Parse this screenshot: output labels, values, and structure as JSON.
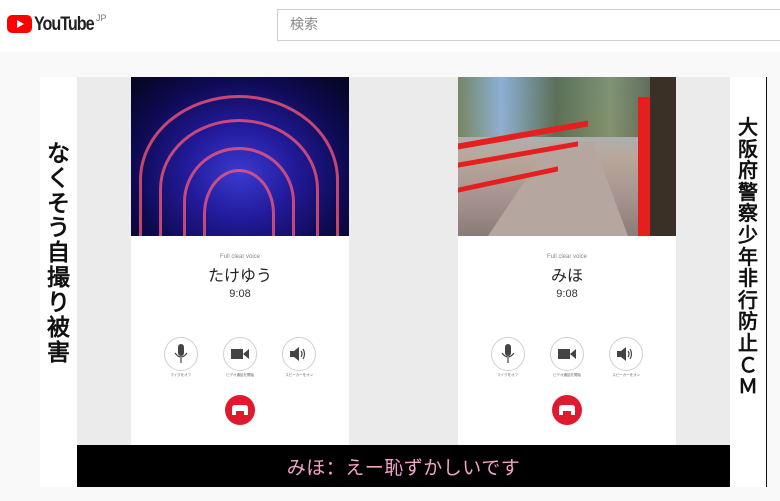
{
  "header": {
    "logo_text": "YouTube",
    "logo_region": "JP",
    "search_placeholder": "検索"
  },
  "video": {
    "side_left_text": [
      "な",
      "く",
      "そ",
      "う",
      "自",
      "撮",
      "り",
      "被",
      "害"
    ],
    "side_right_text": [
      "大",
      "阪",
      "府",
      "警",
      "察",
      "少",
      "年",
      "非",
      "行",
      "防",
      "止",
      "Ｃ",
      "Ｍ"
    ],
    "phones": [
      {
        "photo": "illumination-tunnel",
        "subtitle": "Full clear voice",
        "caller_name": "たけゆう",
        "call_time": "9:08",
        "controls": [
          {
            "icon": "microphone-icon",
            "label": "マイクをオフ"
          },
          {
            "icon": "video-camera-icon",
            "label": "ビデオ通話を開始"
          },
          {
            "icon": "speaker-icon",
            "label": "スピーカーをオン"
          }
        ],
        "end_call_icon": "end-call-icon"
      },
      {
        "photo": "red-bridge",
        "subtitle": "Full clear voice",
        "caller_name": "みほ",
        "call_time": "9:08",
        "controls": [
          {
            "icon": "microphone-icon",
            "label": "マイクをオフ"
          },
          {
            "icon": "video-camera-icon",
            "label": "ビデオ通話を開始"
          },
          {
            "icon": "speaker-icon",
            "label": "スピーカーをオン"
          }
        ],
        "end_call_icon": "end-call-icon"
      }
    ],
    "caption": "みほ：えー恥ずかしいです",
    "colors": {
      "caption_text": "#f3a2c8",
      "end_call": "#e01a2e",
      "brand_red": "#ff0000"
    }
  }
}
